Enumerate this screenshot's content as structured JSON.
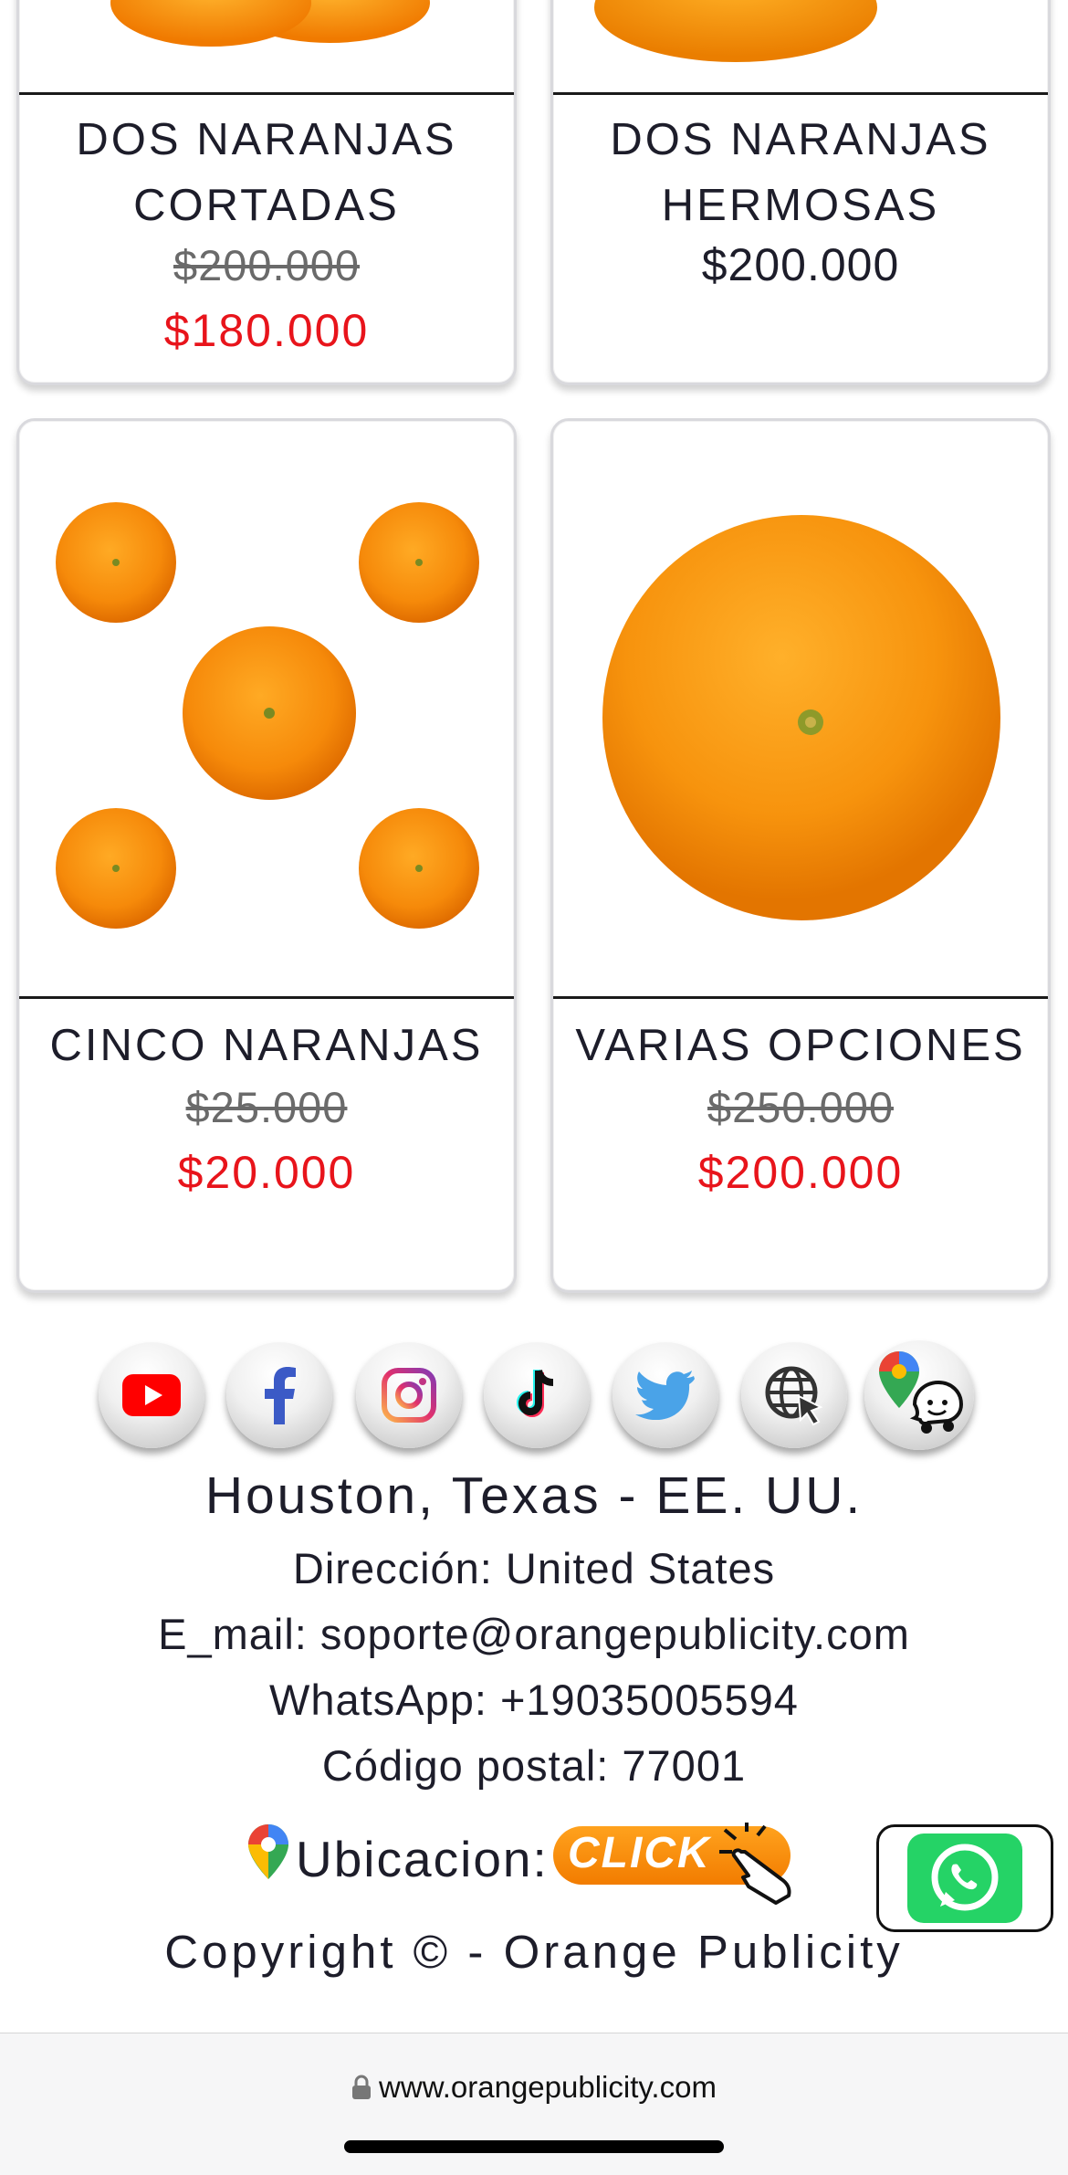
{
  "products": [
    {
      "title_line1": "DOS NARANJAS",
      "title_line2": "CORTADAS",
      "old_price": "$200.000",
      "price": "$180.000"
    },
    {
      "title_line1": "DOS NARANJAS",
      "title_line2": "HERMOSAS",
      "price": "$200.000"
    },
    {
      "title": "CINCO NARANJAS",
      "old_price": "$25.000",
      "price": "$20.000"
    },
    {
      "title": "VARIAS OPCIONES",
      "old_price": "$250.000",
      "price": "$200.000"
    }
  ],
  "social_icons": [
    "youtube-icon",
    "facebook-icon",
    "instagram-icon",
    "tiktok-icon",
    "twitter-icon",
    "website-icon",
    "maps-waze-icon"
  ],
  "footer": {
    "location": "Houston, Texas - EE. UU.",
    "address": "Dirección: United States",
    "email": "E_mail: soporte@orangepublicity.com",
    "whatsapp": "WhatsApp: +19035005594",
    "postal": "Código postal: 77001",
    "ubicacion_label": "Ubicacion:",
    "click_label": "CLICK",
    "copyright": "Copyright © - Orange Publicity"
  },
  "browser": {
    "url": "www.orangepublicity.com"
  },
  "colors": {
    "sale_price": "#e8141b",
    "orange": "#f7931e",
    "whatsapp_green": "#25d366"
  }
}
